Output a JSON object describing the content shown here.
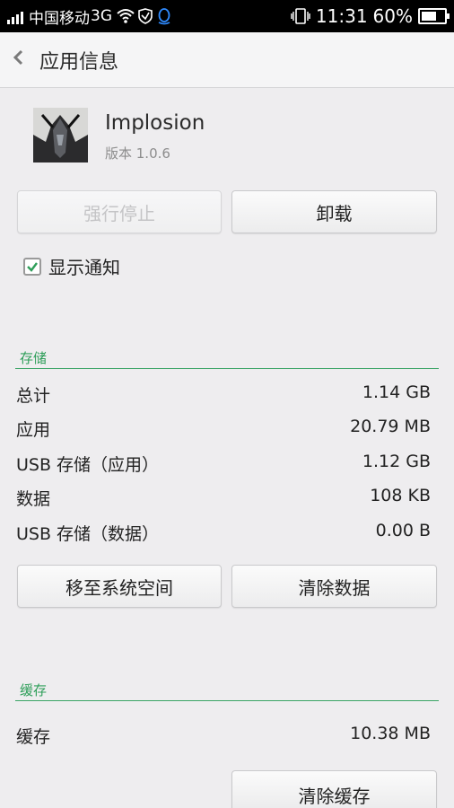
{
  "status_bar": {
    "carrier": "中国移动",
    "network": "3G",
    "time": "11:31",
    "battery": "60%"
  },
  "header": {
    "back_icon": "chevron-left-icon",
    "title": "应用信息"
  },
  "app": {
    "name": "Implosion",
    "version": "版本 1.0.6"
  },
  "buttons": {
    "force_stop": "强行停止",
    "uninstall": "卸载",
    "move_to_system": "移至系统空间",
    "clear_data": "清除数据",
    "clear_cache": "清除缓存"
  },
  "notification": {
    "label": "显示通知",
    "checked": true
  },
  "storage": {
    "title": "存储",
    "rows": [
      {
        "label": "总计",
        "value": "1.14 GB"
      },
      {
        "label": "应用",
        "value": "20.79 MB"
      },
      {
        "label": "USB 存储（应用）",
        "value": "1.12 GB"
      },
      {
        "label": "数据",
        "value": "108 KB"
      },
      {
        "label": "USB 存储（数据）",
        "value": "0.00 B"
      }
    ]
  },
  "cache": {
    "title": "缓存",
    "label": "缓存",
    "value": "10.38 MB"
  },
  "colors": {
    "accent": "#2e9e59",
    "status_bar": "#000000",
    "background": "#eeedef"
  }
}
